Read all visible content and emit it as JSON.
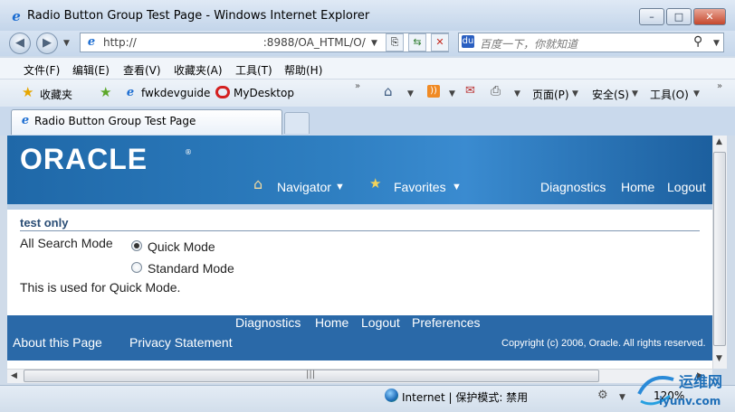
{
  "window": {
    "title": "Radio Button Group Test Page - Windows Internet Explorer",
    "minimize": "–",
    "maximize": "□",
    "close": "✕"
  },
  "address": {
    "url_prefix": "http://",
    "url_suffix": ":8988/OA_HTML/O/",
    "search_placeholder": "百度一下，你就知道"
  },
  "menu": [
    "文件(F)",
    "编辑(E)",
    "查看(V)",
    "收藏夹(A)",
    "工具(T)",
    "帮助(H)"
  ],
  "favorites": {
    "label": "收藏夹",
    "links": [
      "fwkdevguide",
      "MyDesktop"
    ],
    "commands": {
      "page": "页面(P)",
      "safety": "安全(S)",
      "tools": "工具(O)"
    }
  },
  "tab": {
    "title": "Radio Button Group Test Page"
  },
  "page": {
    "brand": "ORACLE",
    "nav": {
      "navigator": "Navigator",
      "favorites": "Favorites"
    },
    "global_links": [
      "Diagnostics",
      "Home",
      "Logout"
    ],
    "section_title": "test only",
    "field_label": "All Search Mode",
    "radio_options": [
      {
        "label": "Quick Mode",
        "selected": true
      },
      {
        "label": "Standard Mode",
        "selected": false
      }
    ],
    "tip": "This is used for Quick Mode.",
    "footer_links": [
      "Diagnostics",
      "Home",
      "Logout",
      "Preferences"
    ],
    "about": "About this Page",
    "privacy": "Privacy Statement",
    "copyright": "Copyright (c) 2006, Oracle. All rights reserved."
  },
  "status": {
    "zone": "Internet | 保护模式: 禁用",
    "zoom": "120%"
  },
  "watermark": {
    "text": "运维网",
    "sub": "iyunv.com"
  },
  "colors": {
    "oracle_header": "#2e7ec0",
    "footer": "#2a69a8",
    "section_title": "#2a4d75"
  }
}
